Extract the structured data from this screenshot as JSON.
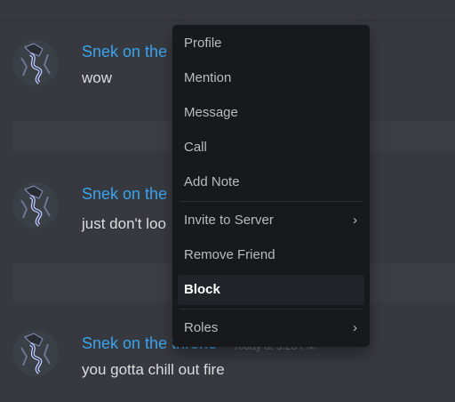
{
  "messages": [
    {
      "author": "Snek on the",
      "timestamp": "",
      "text": "wow"
    },
    {
      "author": "Snek on the",
      "timestamp": "",
      "text": "just don't loo"
    },
    {
      "author": "Snek on the throne",
      "timestamp": "Today at 3:23 PM",
      "text": "you gotta chill out fire"
    }
  ],
  "context_menu": {
    "items": [
      {
        "label": "Profile"
      },
      {
        "label": "Mention"
      },
      {
        "label": "Message"
      },
      {
        "label": "Call"
      },
      {
        "label": "Add Note"
      },
      {
        "label": "Invite to Server",
        "submenu_icon": "chevron-right-icon"
      },
      {
        "label": "Remove Friend"
      },
      {
        "label": "Block"
      },
      {
        "label": "Roles",
        "submenu_icon": "chevron-right-icon"
      }
    ],
    "chevron_glyph": "›"
  },
  "colors": {
    "background": "#36393f",
    "menu_background": "#18191c",
    "username": "#3ba4ee",
    "message_text": "#dcddde",
    "menu_text": "#b9bbbe"
  }
}
